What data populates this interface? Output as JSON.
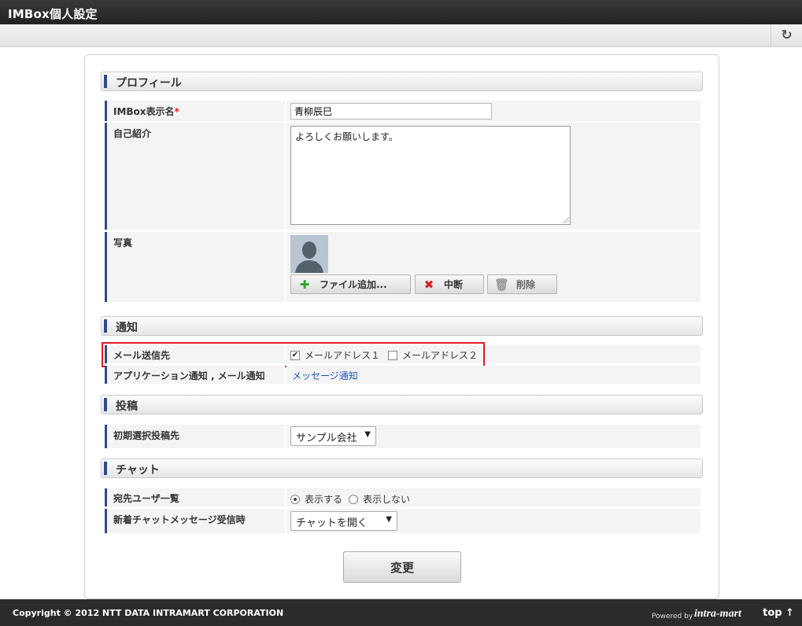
{
  "window": {
    "title": "IMBox個人設定"
  },
  "toolbar": {
    "refresh_icon": "↻"
  },
  "sections": {
    "profile": "プロフィール",
    "notify": "通知",
    "post": "投稿",
    "chat": "チャット"
  },
  "profile": {
    "display_name_label": "IMBox表示名",
    "required_mark": "*",
    "display_name_value": "青柳辰巳",
    "intro_label": "自己紹介",
    "intro_value": "よろしくお願いします。",
    "photo_label": "写真",
    "add_file_label": "ファイル追加...",
    "cancel_label": "中断",
    "delete_label": "削除"
  },
  "notify": {
    "mail_to_label": "メール送信先",
    "mail1_label": "メールアドレス１",
    "mail1_checked": true,
    "mail2_label": "メールアドレス２",
    "mail2_checked": false,
    "app_notify_label": "アプリケーション通知 , メール通知",
    "app_notify_link": "メッセージ通知"
  },
  "post": {
    "default_target_label": "初期選択投稿先",
    "default_target_value": "サンプル会社"
  },
  "chat": {
    "recipients_label": "宛先ユーザ一覧",
    "show_label": "表示する",
    "hide_label": "表示しない",
    "show_selected": true,
    "new_message_label": "新着チャットメッセージ受信時",
    "new_message_value": "チャットを開く"
  },
  "actions": {
    "submit_label": "変更"
  },
  "footer": {
    "copyright": "Copyright © 2012 NTT DATA INTRAMART CORPORATION",
    "powered_by": "Powered by",
    "logo_text": "intra-mart",
    "top_link": "top ↑"
  }
}
